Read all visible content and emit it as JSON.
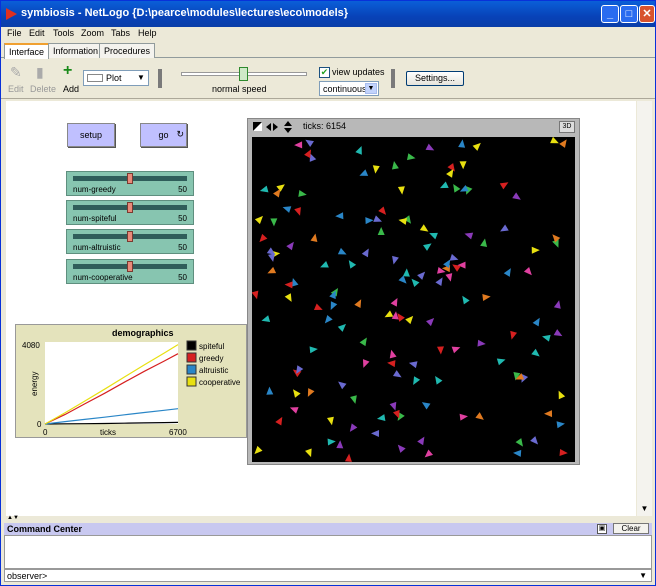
{
  "window": {
    "title": "symbiosis - NetLogo {D:\\pearce\\modules\\lectures\\eco\\models}"
  },
  "menu": [
    "File",
    "Edit",
    "Tools",
    "Zoom",
    "Tabs",
    "Help"
  ],
  "tabs": [
    "Interface",
    "Information",
    "Procedures"
  ],
  "toolbar": {
    "edit_label": "Edit",
    "delete_label": "Delete",
    "add_label": "Add",
    "widget_type": "Plot",
    "speed_label": "normal speed",
    "speed_value": 0.5,
    "view_updates_label": "view updates",
    "view_updates_checked": true,
    "update_mode": "continuous",
    "settings_label": "Settings..."
  },
  "buttons": {
    "setup": "setup",
    "go": "go"
  },
  "sliders": [
    {
      "name": "num-greedy",
      "value": "50",
      "fraction": 0.5
    },
    {
      "name": "num-spiteful",
      "value": "50",
      "fraction": 0.5
    },
    {
      "name": "num-altruistic",
      "value": "50",
      "fraction": 0.5
    },
    {
      "name": "num-cooperative",
      "value": "50",
      "fraction": 0.5
    }
  ],
  "view": {
    "ticks_label": "ticks: 6154",
    "btn_3d": "3D"
  },
  "command_center": {
    "title": "Command Center",
    "clear_label": "Clear",
    "prompt": "observer>"
  },
  "chart_data": {
    "type": "line",
    "title": "demographics",
    "xlabel": "ticks",
    "ylabel": "energy",
    "xlim": [
      0,
      6700
    ],
    "ylim": [
      0,
      4080
    ],
    "x_tick_labels": [
      "0",
      "6700"
    ],
    "y_tick_labels": [
      "0",
      "4080"
    ],
    "legend_position": "right",
    "series": [
      {
        "name": "spiteful",
        "color": "#000000",
        "x": [
          0,
          1000,
          2000,
          3000,
          4000,
          5000,
          6000,
          6700
        ],
        "y": [
          0,
          8,
          15,
          25,
          40,
          55,
          70,
          80
        ]
      },
      {
        "name": "greedy",
        "color": "#d62020",
        "x": [
          0,
          1000,
          2000,
          3000,
          4000,
          5000,
          6000,
          6700
        ],
        "y": [
          0,
          470,
          1000,
          1530,
          2080,
          2620,
          3130,
          3500
        ]
      },
      {
        "name": "altruistic",
        "color": "#2a86c7",
        "x": [
          0,
          1000,
          2000,
          3000,
          4000,
          5000,
          6000,
          6700
        ],
        "y": [
          0,
          120,
          230,
          340,
          460,
          570,
          680,
          760
        ]
      },
      {
        "name": "cooperative",
        "color": "#e8e010",
        "x": [
          0,
          1000,
          2000,
          3000,
          4000,
          5000,
          6000,
          6700
        ],
        "y": [
          0,
          550,
          1140,
          1730,
          2340,
          2940,
          3530,
          3950
        ]
      }
    ]
  }
}
